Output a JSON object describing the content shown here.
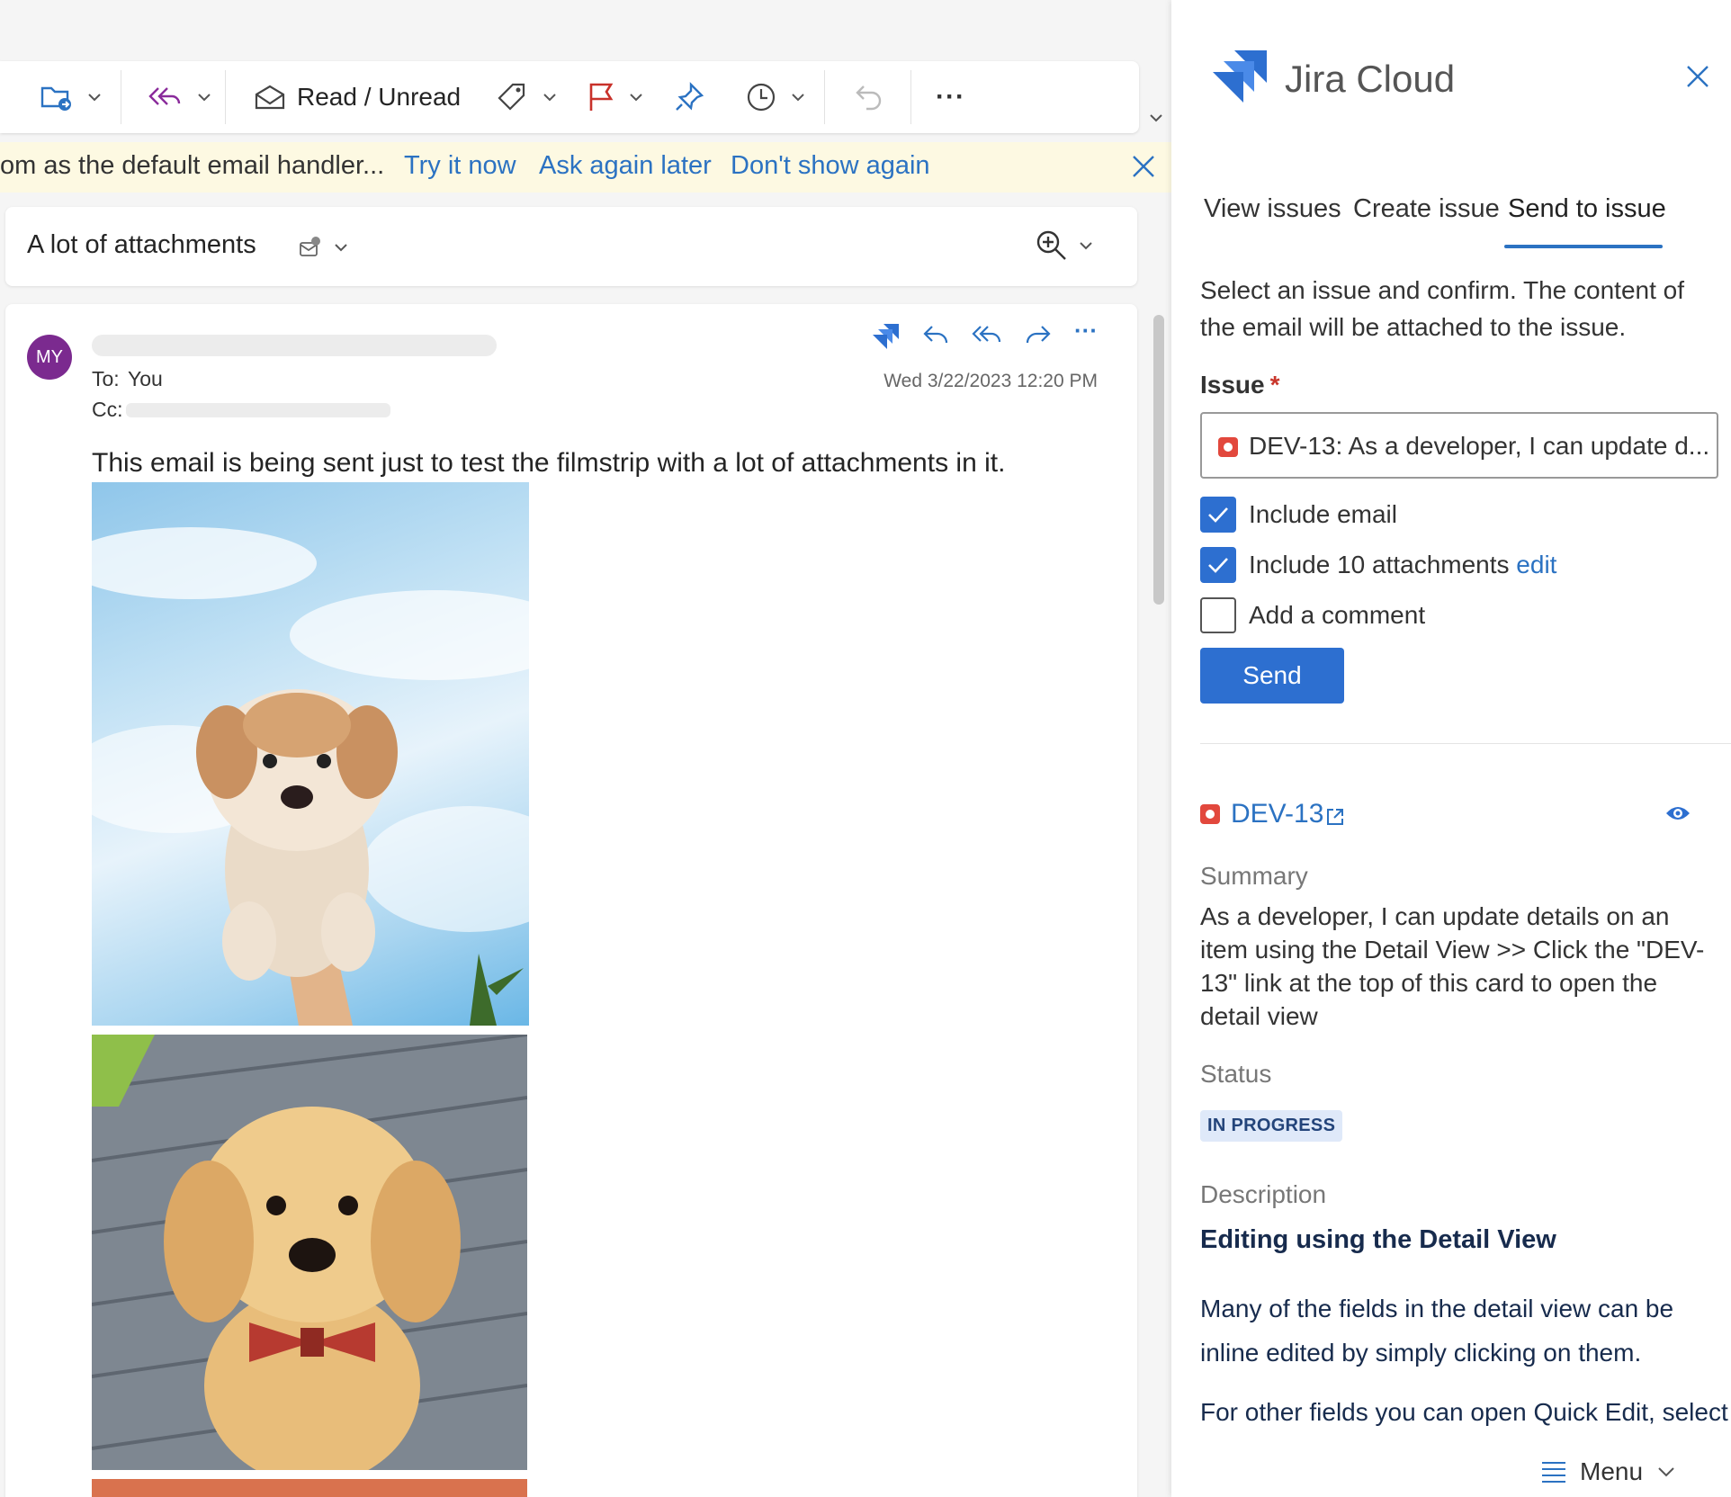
{
  "toolbar": {
    "read_unread_label": "Read / Unread",
    "more_label": "···"
  },
  "banner": {
    "message": "om as the default email handler...",
    "try_now": "Try it now",
    "ask_later": "Ask again later",
    "dont_show": "Don't show again"
  },
  "conversation": {
    "subject": "A lot of attachments"
  },
  "message": {
    "avatar_initials": "MY",
    "to_label": "To:",
    "to_value": "You",
    "cc_label": "Cc:",
    "date": "Wed 3/22/2023 12:20 PM",
    "body": "This email is being sent just to test the filmstrip with a lot of attachments in it."
  },
  "addin": {
    "title": "Jira Cloud",
    "tabs": [
      {
        "label": "View issues",
        "selected": false
      },
      {
        "label": "Create issue",
        "selected": false
      },
      {
        "label": "Send to issue",
        "selected": true
      }
    ],
    "instructions": "Select an issue and confirm. The content of the email will be attached to the issue.",
    "issue_label": "Issue",
    "required_mark": "*",
    "issue_value": "DEV-13: As a developer, I can update d...",
    "options": [
      {
        "label": "Include email",
        "checked": true
      },
      {
        "label": "Include 10 attachments",
        "link": "edit",
        "checked": true
      },
      {
        "label": "Add a comment",
        "checked": false
      }
    ],
    "send_label": "Send",
    "issue": {
      "key": "DEV-13",
      "summary_label": "Summary",
      "summary": "As a developer, I can update details on an item using the Detail View >> Click the \"DEV-13\" link at the top of this card to open the detail view",
      "status_label": "Status",
      "status": "IN PROGRESS",
      "description_label": "Description",
      "description_heading": "Editing using the Detail View",
      "description_p1": "Many of the fields in the detail view can be inline edited by simply clicking on them.",
      "description_p2": "For other fields you can open Quick Edit, select"
    },
    "menu_label": "Menu"
  },
  "colors": {
    "accent_blue": "#2d6fd0",
    "link_blue": "#2b72c2",
    "banner_bg": "#fdf9e2",
    "avatar_purple": "#7b2a8f",
    "issue_red": "#e2483d",
    "lozenge_bg": "#dfe9f9"
  }
}
